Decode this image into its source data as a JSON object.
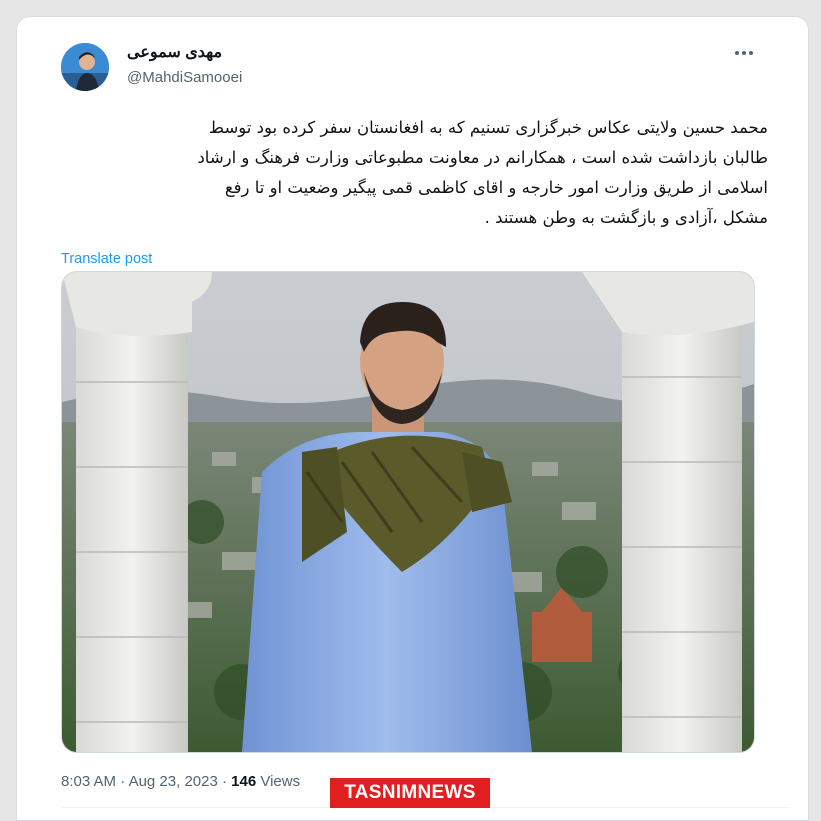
{
  "author": {
    "display_name": "مهدی سموعی",
    "handle": "@MahdiSamooei"
  },
  "tweet": {
    "text": "محمد حسین ولایتی عکاس خبرگزاری تسنیم که به افغانستان سفر کرده بود توسط\nطالبان بازداشت شده است ، همکارانم در معاونت مطبوعاتی وزارت فرهنگ و ارشاد\nاسلامی از طریق وزارت امور خارجه  و اقای کاظمی قمی پیگیر وضعیت او تا رفع\nمشکل ،آزادی و بازگشت به وطن هستند ."
  },
  "translate_link": "Translate post",
  "meta": {
    "time": "8:03 AM",
    "sep1": " · ",
    "date": "Aug 23, 2023",
    "sep2": " · ",
    "views_count": "146",
    "views_label": " Views"
  },
  "watermark": "TASNIMNEWS",
  "icons": {
    "more": "more-horizontal-icon"
  },
  "colors": {
    "link": "#1d9bf0",
    "secondary_text": "#536471",
    "watermark_bg": "#e11f20"
  }
}
